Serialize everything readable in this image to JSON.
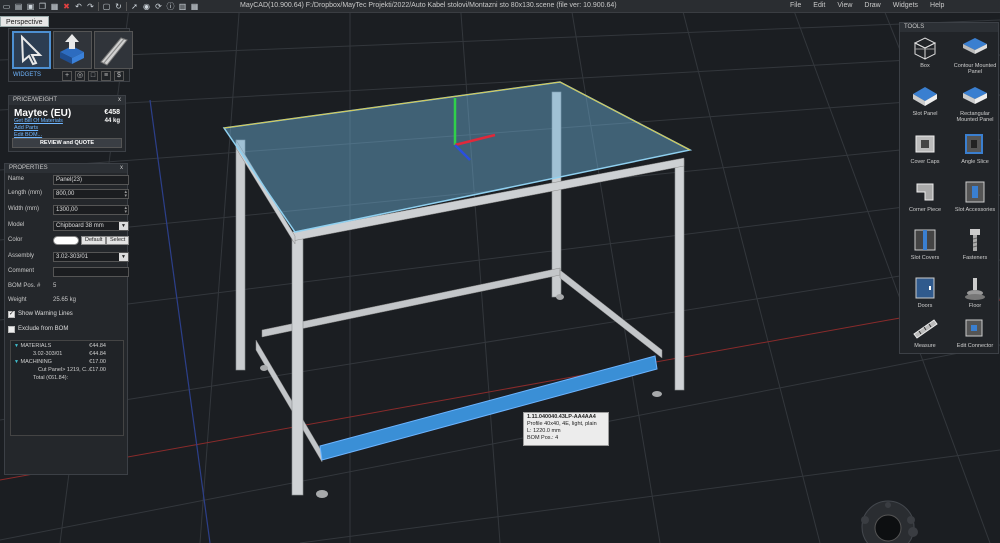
{
  "titlebar": {
    "title": "MayCAD(10.900.64) F:/Dropbox/MayTec Projekti/2022/Auto Kabel stolovi/Montazni sto 80x130.scene (file ver: 10.900.64)",
    "menu": [
      "File",
      "Edit",
      "View",
      "Draw",
      "Widgets",
      "Help"
    ],
    "quick_access_icons": [
      "new-icon",
      "open-icon",
      "save-icon",
      "copy-icon",
      "paste-icon",
      "delete-icon",
      "undo-icon",
      "redo-icon",
      "screen-icon",
      "rotate-icon",
      "select-icon",
      "globe-icon",
      "refresh-icon",
      "info-icon",
      "grid-icon",
      "layers-icon"
    ]
  },
  "viewport": {
    "tab": "Perspective"
  },
  "widgets": {
    "label": "WIDGETS",
    "tools": [
      "select-arrow-icon",
      "move-up-icon",
      "profile-icon"
    ],
    "buttons": [
      "+",
      "◎",
      "□",
      "≡",
      "$"
    ]
  },
  "price": {
    "header": "PRICE/WEIGHT",
    "close": "x",
    "brand": "Maytec (EU)",
    "price": "€458",
    "weight": "44 kg",
    "links": [
      "Get Bill Of Materials",
      "Add Parts",
      "Edit BOM..."
    ],
    "review_button": "REVIEW and QUOTE"
  },
  "properties": {
    "header": "PROPERTIES",
    "close": "x",
    "name": {
      "label": "Name",
      "value": "Panel(23)"
    },
    "length": {
      "label": "Length  (mm)",
      "value": "800,00"
    },
    "width": {
      "label": "Width  (mm)",
      "value": "1300,00"
    },
    "model": {
      "label": "Model",
      "value": "Chipboard 38 mm"
    },
    "color": {
      "label": "Color",
      "default_btn": "Default",
      "select_btn": "Select"
    },
    "assembly": {
      "label": "Assembly",
      "value": "3.02-303/01"
    },
    "comment": {
      "label": "Comment",
      "value": ""
    },
    "bom_pos": {
      "label": "BOM Pos. #",
      "value": "5"
    },
    "weight": {
      "label": "Weight",
      "value": "25.65 kg"
    },
    "show_warning": {
      "label": "Show Warning Lines",
      "checked": true
    },
    "exclude_bom": {
      "label": "Exclude from BOM",
      "checked": false
    },
    "materials": [
      {
        "label": "MATERIALS",
        "value": "€44.84",
        "indent": 0,
        "toggle": true
      },
      {
        "label": "3.02-303/01",
        "value": "€44.84",
        "indent": 1,
        "toggle": false
      },
      {
        "label": "MACHINING",
        "value": "€17.00",
        "indent": 0,
        "toggle": true
      },
      {
        "label": "Cut Panel> 1219, C...",
        "value": "€17.00",
        "indent": 2,
        "toggle": false
      },
      {
        "label": "Total (€61.84):",
        "value": "",
        "indent": 1,
        "toggle": false
      }
    ]
  },
  "tools": {
    "header": "TOOLS",
    "items": [
      {
        "label": "Box",
        "icon": "box-icon"
      },
      {
        "label": "Contour Mounted Panel",
        "icon": "contour-panel-icon"
      },
      {
        "label": "Slot Panel",
        "icon": "slot-panel-icon"
      },
      {
        "label": "Rectangular Mounted Panel",
        "icon": "rect-panel-icon"
      },
      {
        "label": "Cover Caps",
        "icon": "cover-caps-icon"
      },
      {
        "label": "Angle Slice",
        "icon": "angle-slice-icon"
      },
      {
        "label": "Corner Piece",
        "icon": "corner-piece-icon"
      },
      {
        "label": "Slot Accessories",
        "icon": "slot-accessories-icon"
      },
      {
        "label": "Slot Covers",
        "icon": "slot-covers-icon"
      },
      {
        "label": "Fasteners",
        "icon": "fasteners-icon"
      },
      {
        "label": "Doors",
        "icon": "doors-icon"
      },
      {
        "label": "Floor",
        "icon": "floor-icon"
      },
      {
        "label": "Measure",
        "icon": "measure-icon"
      },
      {
        "label": "Edit Connector",
        "icon": "edit-connector-icon"
      }
    ]
  },
  "tooltip": {
    "lines": [
      "1.11.040040.43LP-AA4AA4",
      "Profile 40x40, 4E, light, plain",
      "L: 1220.0 mm",
      "BOM Pos.: 4"
    ]
  },
  "colors": {
    "background": "#1b1e22",
    "grid": "#34383d",
    "frame": "#d8dadc",
    "glass": "#6fb4dc",
    "selected_profile": "#3a8fd6",
    "accent": "#4d8fd1"
  }
}
